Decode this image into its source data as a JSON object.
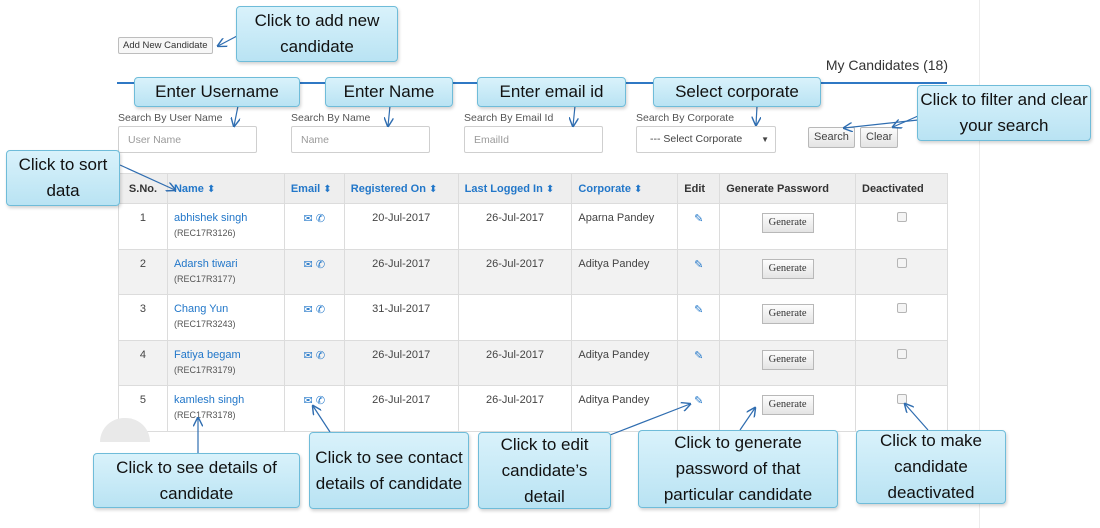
{
  "toolbar": {
    "add_label": "Add New Candidate"
  },
  "page": {
    "title": "My Candidates (18)"
  },
  "filters": {
    "username": {
      "label": "Search By User Name",
      "placeholder": "User Name"
    },
    "name": {
      "label": "Search By Name",
      "placeholder": "Name"
    },
    "email": {
      "label": "Search By Email Id",
      "placeholder": "EmailId"
    },
    "corporate": {
      "label": "Search By Corporate",
      "selected": "--- Select Corporate"
    },
    "search_label": "Search",
    "clear_label": "Clear"
  },
  "table": {
    "headers": {
      "sno": "S.No.",
      "name": "Name",
      "email": "Email",
      "registered": "Registered On",
      "last_logged": "Last Logged In",
      "corporate": "Corporate",
      "edit": "Edit",
      "generate": "Generate Password",
      "deactivated": "Deactivated"
    },
    "sort_icon": "sort-arrows-icon",
    "generate_label": "Generate",
    "rows": [
      {
        "sno": "1",
        "name": "abhishek singh",
        "code": "(REC17R3126)",
        "registered": "20-Jul-2017",
        "last_logged": "26-Jul-2017",
        "corporate": "Aparna Pandey"
      },
      {
        "sno": "2",
        "name": "Adarsh tiwari",
        "code": "(REC17R3177)",
        "registered": "26-Jul-2017",
        "last_logged": "26-Jul-2017",
        "corporate": "Aditya Pandey"
      },
      {
        "sno": "3",
        "name": "Chang Yun",
        "code": "(REC17R3243)",
        "registered": "31-Jul-2017",
        "last_logged": "",
        "corporate": ""
      },
      {
        "sno": "4",
        "name": "Fatiya begam",
        "code": "(REC17R3179)",
        "registered": "26-Jul-2017",
        "last_logged": "26-Jul-2017",
        "corporate": "Aditya Pandey"
      },
      {
        "sno": "5",
        "name": "kamlesh singh",
        "code": "(REC17R3178)",
        "registered": "26-Jul-2017",
        "last_logged": "26-Jul-2017",
        "corporate": "Aditya Pandey"
      }
    ]
  },
  "callouts": {
    "add": "Click to add new candidate",
    "username": "Enter Username",
    "name": "Enter Name",
    "email": "Enter email id",
    "corporate": "Select corporate",
    "filter": "Click to filter and clear your search",
    "sort": "Click to sort data",
    "details": "Click to see details of candidate",
    "contact": "Click to see contact details of candidate",
    "edit": "Click to edit candidate’s detail",
    "generate": "Click to generate password of that particular candidate",
    "deactivate": "Click to make candidate deactivated"
  },
  "colors": {
    "accent": "#2277c9",
    "rule": "#2f78c4",
    "callout_fill": "#c8ebf7",
    "callout_border": "#6fbcd9"
  },
  "icons": {
    "email": "envelope-icon",
    "phone": "phone-icon",
    "edit": "pencil-icon",
    "sort": "sort-arrows-icon"
  }
}
